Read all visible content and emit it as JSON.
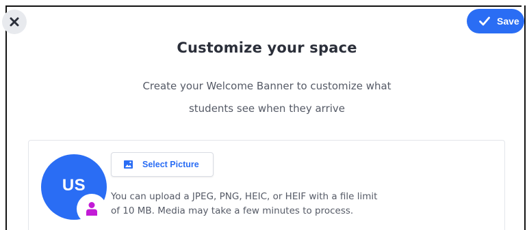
{
  "window": {
    "close_icon": "close-icon",
    "save_label": "Save",
    "save_icon": "checkmark-icon"
  },
  "header": {
    "title": "Customize your space",
    "subtitle_line1": "Create your Welcome Banner to customize what",
    "subtitle_line2": "students see when they arrive"
  },
  "banner": {
    "avatar_initials": "US",
    "avatar_badge_icon": "person-icon",
    "select_picture_label": "Select Picture",
    "select_picture_icon": "image-icon",
    "upload_info_line1": "You can upload a JPEG, PNG, HEIC, or HEIF with a file limit",
    "upload_info_line2": "of 10 MB. Media may take a few minutes to process."
  },
  "colors": {
    "accent": "#2a6df4",
    "badge_person": "#c21bd6",
    "title_text": "#2b2f3a",
    "body_text": "#555a66"
  }
}
